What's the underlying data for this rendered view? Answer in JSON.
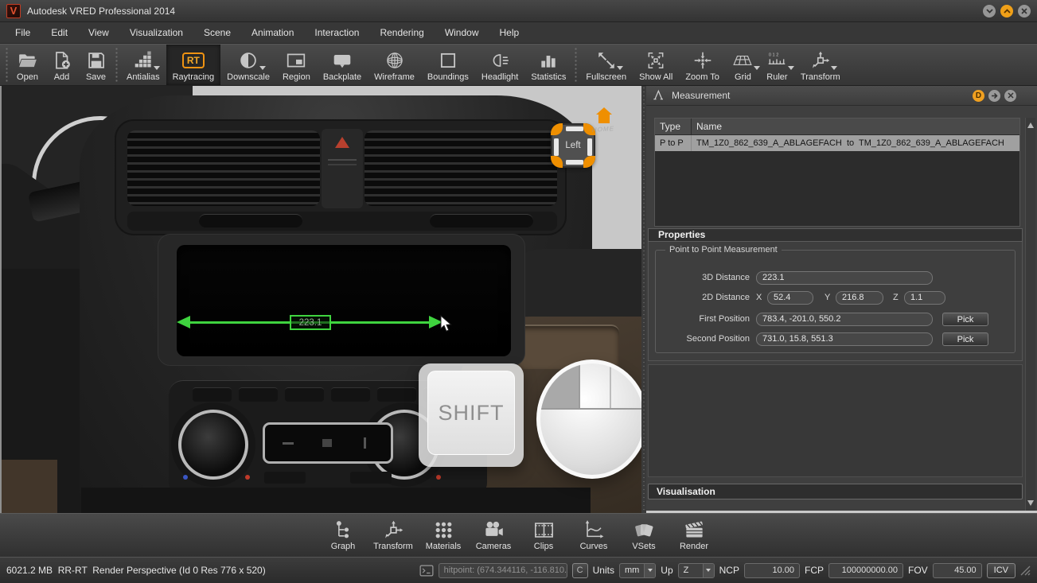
{
  "window": {
    "title": "Autodesk VRED Professional 2014"
  },
  "menu": {
    "items": [
      "File",
      "Edit",
      "View",
      "Visualization",
      "Scene",
      "Animation",
      "Interaction",
      "Rendering",
      "Window",
      "Help"
    ]
  },
  "toolbar": {
    "ruler_digits": "0 1 2",
    "items": [
      {
        "label": "Open"
      },
      {
        "label": "Add"
      },
      {
        "label": "Save"
      },
      {
        "label": "Antialias"
      },
      {
        "label": "Raytracing",
        "badge": "RT",
        "active": true
      },
      {
        "label": "Downscale"
      },
      {
        "label": "Region"
      },
      {
        "label": "Backplate"
      },
      {
        "label": "Wireframe"
      },
      {
        "label": "Boundings"
      },
      {
        "label": "Headlight"
      },
      {
        "label": "Statistics"
      },
      {
        "label": "Fullscreen"
      },
      {
        "label": "Show All"
      },
      {
        "label": "Zoom To"
      },
      {
        "label": "Grid"
      },
      {
        "label": "Ruler"
      },
      {
        "label": "Transform"
      }
    ]
  },
  "viewport": {
    "measurement_label": "223.1",
    "nav_cube": {
      "face_label": "Left"
    },
    "home_label": "HOME",
    "overlay": {
      "key_label": "SHIFT"
    }
  },
  "panel": {
    "title": "Measurement",
    "header_buttons": {
      "dock": "D"
    },
    "table": {
      "columns": [
        "Type",
        "Name"
      ],
      "rows": [
        {
          "type": "P to P",
          "name": "TM_1Z0_862_639_A_ABLAGEFACH  to  TM_1Z0_862_639_A_ABLAGEFACH"
        }
      ]
    },
    "properties": {
      "header": "Properties",
      "group_title": "Point to Point Measurement",
      "distance3d_label": "3D Distance",
      "distance3d_value": "223.1",
      "distance2d_label": "2D Distance",
      "x_label": "X",
      "x_value": "52.4",
      "y_label": "Y",
      "y_value": "216.8",
      "z_label": "Z",
      "z_value": "1.1",
      "first_position_label": "First Position",
      "first_position_value": "783.4, -201.0, 550.2",
      "second_position_label": "Second Position",
      "second_position_value": "731.0, 15.8, 551.3",
      "pick_label": "Pick"
    },
    "visualisation_header": "Visualisation"
  },
  "dock": {
    "items": [
      {
        "label": "Graph"
      },
      {
        "label": "Transform"
      },
      {
        "label": "Materials"
      },
      {
        "label": "Cameras"
      },
      {
        "label": "Clips"
      },
      {
        "label": "Curves"
      },
      {
        "label": "VSets"
      },
      {
        "label": "Render"
      }
    ]
  },
  "statusbar": {
    "info": "6021.2 MB  RR-RT  Render Perspective (Id 0 Res 776 x 520)",
    "hitpoint_value": "hitpoint: (674.344116, -116.810...",
    "c_button": "C",
    "units_label": "Units",
    "units_value": "mm",
    "up_label": "Up",
    "up_value": "Z",
    "ncp_label": "NCP",
    "ncp_value": "10.00",
    "fcp_label": "FCP",
    "fcp_value": "100000000.00",
    "fov_label": "FOV",
    "fov_value": "45.00",
    "icv_button": "ICV"
  },
  "colors": {
    "accent_orange": "#f29400",
    "measure_green": "#3fd43f",
    "panel_bg": "#3f3f3f",
    "selected_row": "#a0a0a0"
  }
}
